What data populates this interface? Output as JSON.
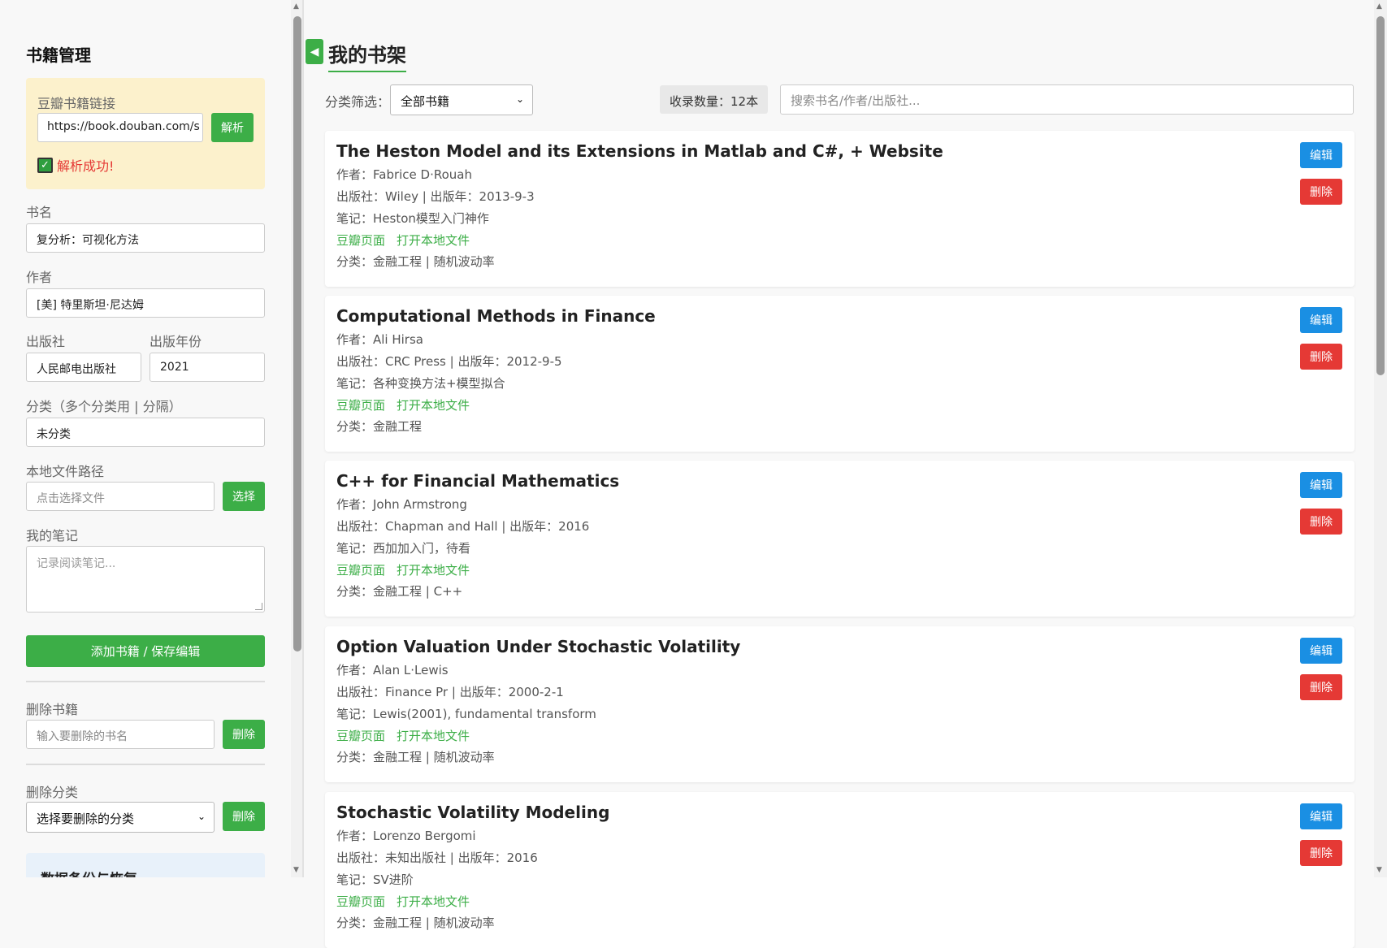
{
  "sidebar": {
    "title": "书籍管理",
    "douban": {
      "label": "豆瓣书籍链接",
      "url_value": "https://book.douban.com/s",
      "parse_label": "解析",
      "status_icon": "✓",
      "status_text": "解析成功!"
    },
    "book_name": {
      "label": "书名",
      "value": "复分析：可视化方法"
    },
    "author": {
      "label": "作者",
      "value": "[美] 特里斯坦·尼达姆"
    },
    "publisher": {
      "label": "出版社",
      "value": "人民邮电出版社"
    },
    "pub_year": {
      "label": "出版年份",
      "value": "2021"
    },
    "category": {
      "label": "分类（多个分类用 | 分隔）",
      "value": "未分类"
    },
    "local_path": {
      "label": "本地文件路径",
      "placeholder": "点击选择文件",
      "button": "选择"
    },
    "notes": {
      "label": "我的笔记",
      "placeholder": "记录阅读笔记..."
    },
    "submit_label": "添加书籍 / 保存编辑",
    "delete_book": {
      "label": "删除书籍",
      "placeholder": "输入要删除的书名",
      "button": "删除"
    },
    "delete_category": {
      "label": "删除分类",
      "selected": "选择要删除的分类",
      "button": "删除"
    },
    "backup_title": "数据备份与恢复"
  },
  "main": {
    "collapse_icon": "◀",
    "title": "我的书架",
    "filter_label": "分类筛选：",
    "filter_selected": "全部书籍",
    "count_text": "收录数量：12本",
    "search_placeholder": "搜索书名/作者/出版社...",
    "edit_label": "编辑",
    "delete_label": "删除",
    "douban_link": "豆瓣页面",
    "local_link": "打开本地文件",
    "books": [
      {
        "title": "The Heston Model and its Extensions in Matlab and C#, + Website",
        "author": "作者：Fabrice D·Rouah",
        "pub": "出版社：Wiley | 出版年：2013-9-3",
        "note": "笔记：Heston模型入门神作",
        "category": "分类：金融工程 | 随机波动率"
      },
      {
        "title": "Computational Methods in Finance",
        "author": "作者：Ali Hirsa",
        "pub": "出版社：CRC Press | 出版年：2012-9-5",
        "note": "笔记：各种变换方法+模型拟合",
        "category": "分类：金融工程"
      },
      {
        "title": "C++ for Financial Mathematics",
        "author": "作者：John Armstrong",
        "pub": "出版社：Chapman and Hall | 出版年：2016",
        "note": "笔记：西加加入门，待看",
        "category": "分类：金融工程 | C++"
      },
      {
        "title": "Option Valuation Under Stochastic Volatility",
        "author": "作者：Alan L·Lewis",
        "pub": "出版社：Finance Pr | 出版年：2000-2-1",
        "note": "笔记：Lewis(2001), fundamental transform",
        "category": "分类：金融工程 | 随机波动率"
      },
      {
        "title": "Stochastic Volatility Modeling",
        "author": "作者：Lorenzo Bergomi",
        "pub": "出版社：未知出版社 | 出版年：2016",
        "note": "笔记：SV进阶",
        "category": "分类：金融工程 | 随机波动率"
      }
    ]
  }
}
